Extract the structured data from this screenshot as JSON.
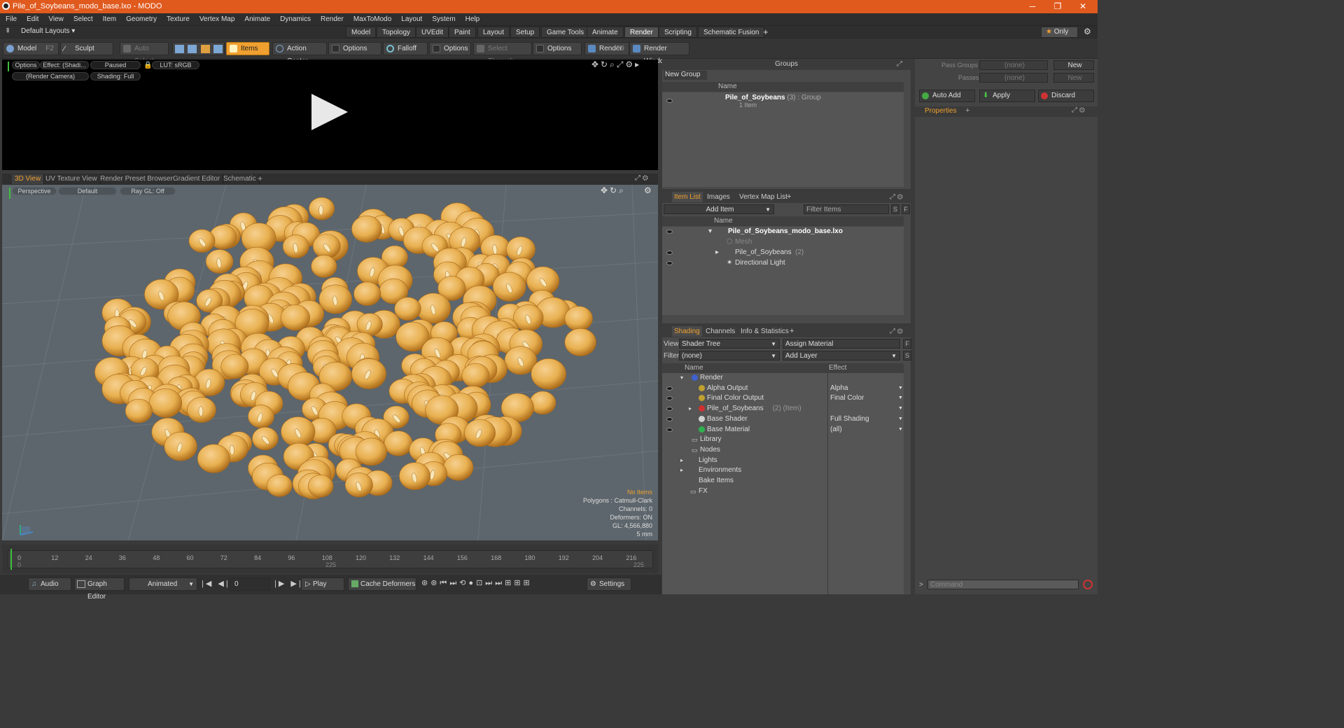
{
  "window": {
    "title": "Pile_of_Soybeans_modo_base.lxo - MODO",
    "controls": [
      "─",
      "❐",
      "✕"
    ]
  },
  "menubar": [
    "File",
    "Edit",
    "View",
    "Select",
    "Item",
    "Geometry",
    "Texture",
    "Vertex Map",
    "Animate",
    "Dynamics",
    "Render",
    "MaxToModo",
    "Layout",
    "System",
    "Help"
  ],
  "layoutbar": {
    "layouts_label": "Default Layouts",
    "tabs": [
      "Model",
      "Topology",
      "UVEdit",
      "Paint",
      "Layout",
      "Setup",
      "Game Tools",
      "Animate",
      "Render",
      "Scripting",
      "Schematic Fusion"
    ],
    "active_tab": "Render",
    "add": "+",
    "only_label": "Only"
  },
  "toolbar": {
    "model": "Model",
    "model_hotkey": "F2",
    "sculpt": "Sculpt",
    "auto_select": "Auto Select",
    "items": "Items",
    "action_center": "Action Center",
    "options1": "Options",
    "falloff": "Falloff",
    "options2": "Options",
    "select_through": "Select Through",
    "options3": "Options",
    "render": "Render",
    "render_hotkey": "F9",
    "render_window": "Render Window"
  },
  "render_preview": {
    "options": "Options",
    "effect": "Effect: (Shadi...",
    "paused": "Paused",
    "lut": "LUT: sRGB",
    "camera": "(Render Camera)",
    "shading": "Shading: Full"
  },
  "view_tabs": {
    "tabs": [
      "3D View",
      "UV Texture View",
      "Render Preset Browser",
      "Gradient Editor",
      "Schematic"
    ],
    "active": "3D View",
    "add": "+"
  },
  "viewport": {
    "perspective": "Perspective",
    "default": "Default",
    "raygl": "Ray GL: Off",
    "stats": {
      "no_items": "No Items",
      "polygons": "Polygons : Catmull-Clark",
      "channels": "Channels: 0",
      "deformers": "Deformers: ON",
      "gl": "GL: 4,566,880",
      "scale": "5 mm"
    }
  },
  "timeline": {
    "ticks": [
      "0",
      "12",
      "24",
      "36",
      "48",
      "60",
      "72",
      "84",
      "96",
      "108",
      "120",
      "132",
      "144",
      "156",
      "168",
      "180",
      "192",
      "204",
      "216"
    ],
    "start_marker": "0",
    "mid_marker": "225",
    "end_marker": "225"
  },
  "bottombar": {
    "audio": "Audio",
    "graph_editor": "Graph Editor",
    "animated": "Animated",
    "frame": "0",
    "play": "Play",
    "cache_deformers": "Cache Deformers",
    "settings": "Settings"
  },
  "groups": {
    "header": "Groups",
    "new_group": "New Group",
    "col_name": "Name",
    "item_name": "Pile_of_Soybeans",
    "item_count": "(3)",
    "item_type": ": Group",
    "item_sub": "1 Item"
  },
  "passes": {
    "pass_groups_label": "Pass Groups",
    "pass_groups_value": "(none)",
    "passes_label": "Passes",
    "passes_value": "(none)",
    "new1": "New",
    "new2": "New",
    "auto_add": "Auto Add",
    "apply": "Apply",
    "discard": "Discard",
    "properties_tab": "Properties",
    "add": "+"
  },
  "item_list": {
    "tabs": [
      "Item List",
      "Images",
      "Vertex Map List"
    ],
    "active": "Item List",
    "add": "+",
    "add_item": "Add Item",
    "filter_items": "Filter Items",
    "s_btn": "S",
    "f_btn": "F",
    "col_name": "Name",
    "rows": [
      {
        "label": "Pile_of_Soybeans_modo_base.lxo",
        "count": "",
        "bold": true
      },
      {
        "label": "Mesh",
        "count": "",
        "dim": true
      },
      {
        "label": "Pile_of_Soybeans",
        "count": "(2)"
      },
      {
        "label": "Directional Light",
        "count": ""
      }
    ]
  },
  "shading": {
    "tabs": [
      "Shading",
      "Channels",
      "Info & Statistics"
    ],
    "active": "Shading",
    "add": "+",
    "view_label": "View",
    "view_value": "Shader Tree",
    "assign_material": "Assign Material",
    "filter_label": "Filter",
    "filter_value": "(none)",
    "add_layer": "Add Layer",
    "f_btn": "F",
    "s_btn": "S",
    "col_name": "Name",
    "col_effect": "Effect",
    "rows": [
      {
        "label": "Render",
        "effect": "",
        "color": "#4060d0"
      },
      {
        "label": "Alpha Output",
        "effect": "Alpha",
        "color": "#c0a030"
      },
      {
        "label": "Final Color Output",
        "effect": "Final Color",
        "color": "#c0a030"
      },
      {
        "label": "Pile_of_Soybeans",
        "suffix": "(2) (Item)",
        "effect": "",
        "color": "#d03030"
      },
      {
        "label": "Base Shader",
        "effect": "Full Shading",
        "color": "#d0d0d0"
      },
      {
        "label": "Base Material",
        "effect": "(all)",
        "color": "#30b050"
      },
      {
        "label": "Library",
        "effect": ""
      },
      {
        "label": "Nodes",
        "effect": ""
      },
      {
        "label": "Lights",
        "effect": ""
      },
      {
        "label": "Environments",
        "effect": ""
      },
      {
        "label": "Bake Items",
        "effect": ""
      },
      {
        "label": "FX",
        "effect": ""
      }
    ]
  },
  "command": {
    "placeholder": "Command",
    "prompt": ">"
  },
  "colors": {
    "titlebar": "#e05a1e",
    "accent": "#f0a030",
    "viewport_bg": "#5d666c",
    "soybean": "#e8b050"
  }
}
